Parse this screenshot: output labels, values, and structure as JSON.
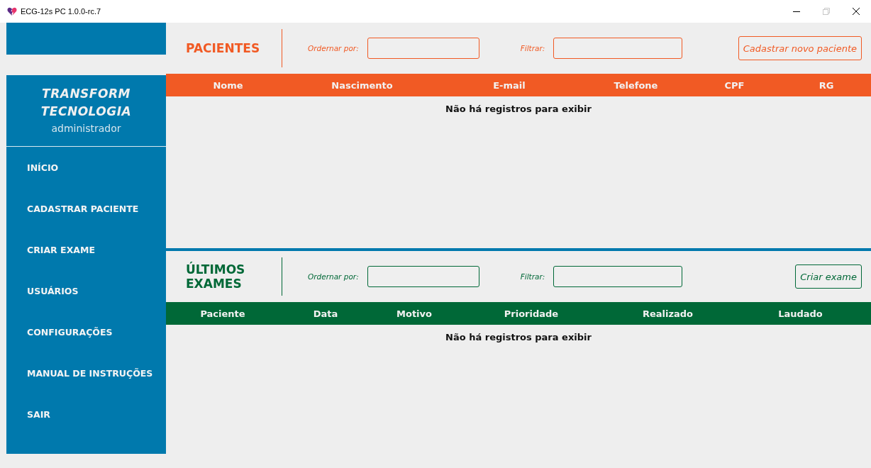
{
  "window": {
    "title": "ECG-12s PC 1.0.0-rc.7"
  },
  "sidebar": {
    "company_line_1": "TRANSFORM",
    "company_line_2": "TECNOLOGIA",
    "role": "administrador",
    "items": [
      {
        "label": "INÍCIO"
      },
      {
        "label": "CADASTRAR PACIENTE"
      },
      {
        "label": "CRIAR EXAME"
      },
      {
        "label": "USUÁRIOS"
      },
      {
        "label": "CONFIGURAÇÕES"
      },
      {
        "label": "MANUAL DE INSTRUÇÕES"
      },
      {
        "label": "SAIR"
      }
    ]
  },
  "sections": [
    {
      "kind": "patients",
      "title": "PACIENTES",
      "sort_label": "Ordernar por:",
      "filter_label": "Filtrar:",
      "button": "Cadastrar novo paciente",
      "columns": [
        "Nome",
        "Nascimento",
        "E-mail",
        "Telefone",
        "CPF",
        "RG"
      ],
      "empty_message": "Não há registros para exibir"
    },
    {
      "kind": "exams",
      "title": "ÚLTIMOS EXAMES",
      "sort_label": "Ordernar por:",
      "filter_label": "Filtrar:",
      "button": "Criar exame",
      "columns": [
        "Paciente",
        "Data",
        "Motivo",
        "Prioridade",
        "Realizado",
        "Laudado"
      ],
      "empty_message": "Não há registros para exibir"
    }
  ]
}
